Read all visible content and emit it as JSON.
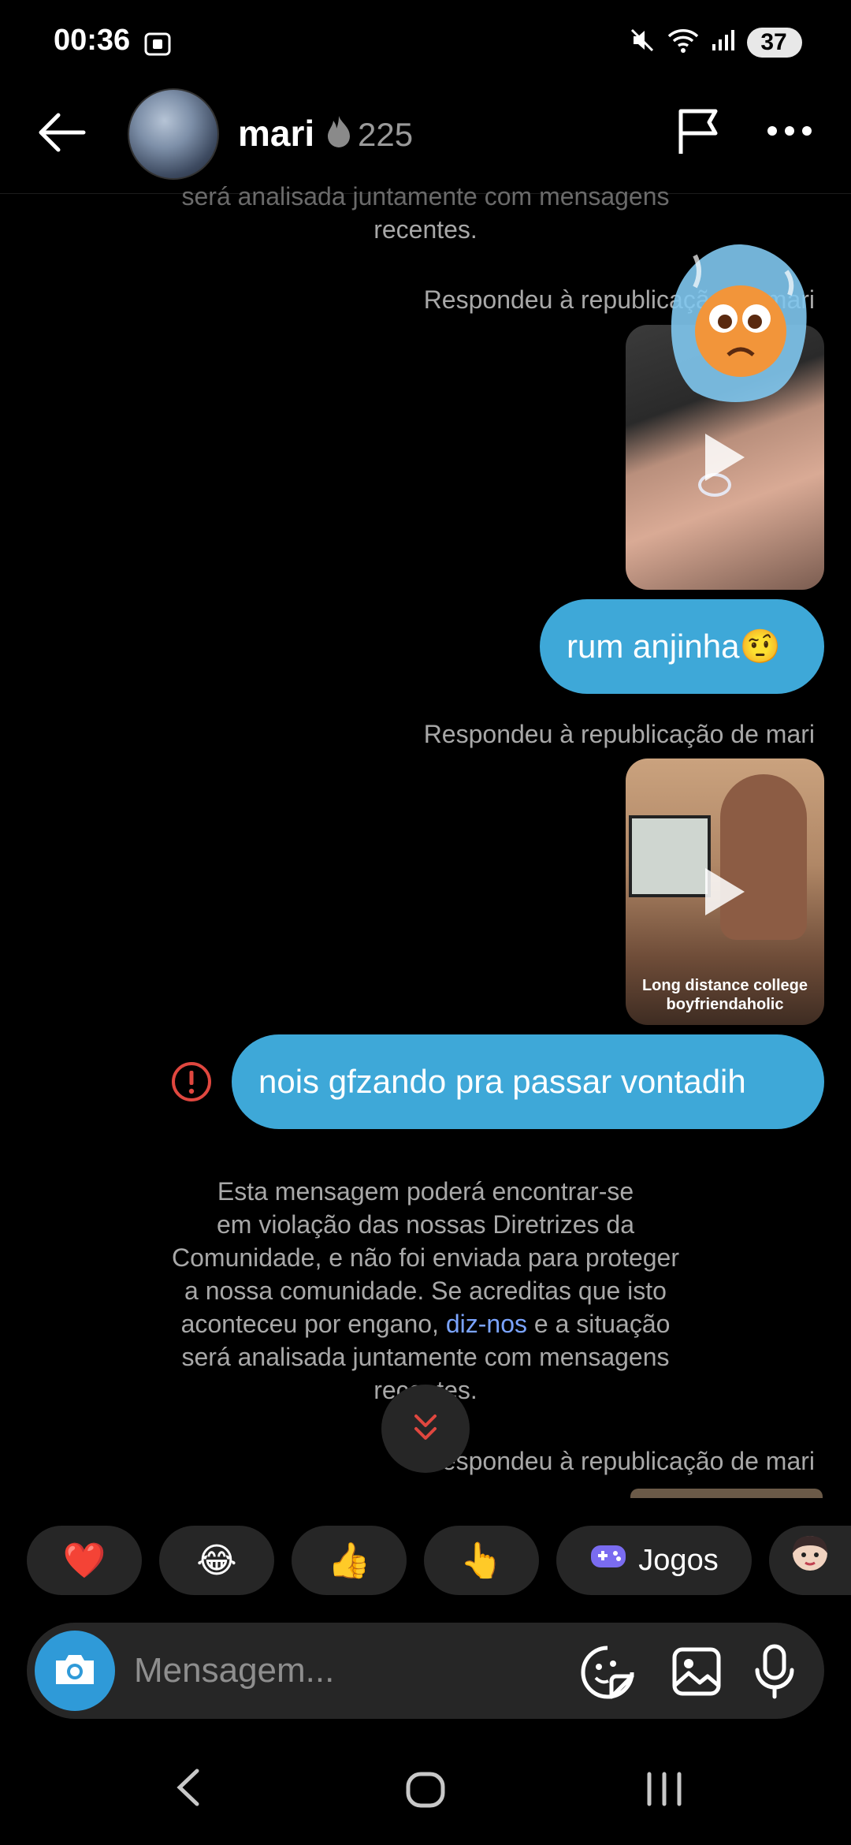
{
  "status": {
    "time": "00:36",
    "battery": "37"
  },
  "header": {
    "name": "mari",
    "streak_count": "225"
  },
  "messages": {
    "top_notice_tail_line1": "será analisada juntamente com mensagens",
    "top_notice_tail_line2": "recentes.",
    "reply_label_1": "Respondeu à republicação de mari",
    "bubble_1": "rum anjinha🤨",
    "reply_label_2": "Respondeu à republicação de mari",
    "video_caption_line1": "Long distance college",
    "video_caption_line2": "boyfriendaholic",
    "bubble_2": "nois gfzando pra passar vontadih",
    "notice_line1": "Esta mensagem poderá encontrar-se",
    "notice_line2": "em violação das nossas Diretrizes da",
    "notice_line3": "Comunidade, e não foi enviada para proteger",
    "notice_line4": "a nossa comunidade. Se acreditas que isto",
    "notice_line5_before": "aconteceu por engano, ",
    "notice_link": "diz-nos",
    "notice_line5_after": " e a situação",
    "notice_line6": "será analisada juntamente com mensagens",
    "notice_line7": "recentes.",
    "reply_label_3": "Respondeu à republicação de mari"
  },
  "quick_reactions": {
    "heart": "❤️",
    "laugh": "😂",
    "thumbs_up": "👍",
    "point": "👆",
    "games_label": "Jogos"
  },
  "composer": {
    "placeholder": "Mensagem..."
  },
  "colors": {
    "bubble": "#3ea8d8",
    "link": "#7ba4ff",
    "error": "#e0473f",
    "chip": "#262626"
  }
}
